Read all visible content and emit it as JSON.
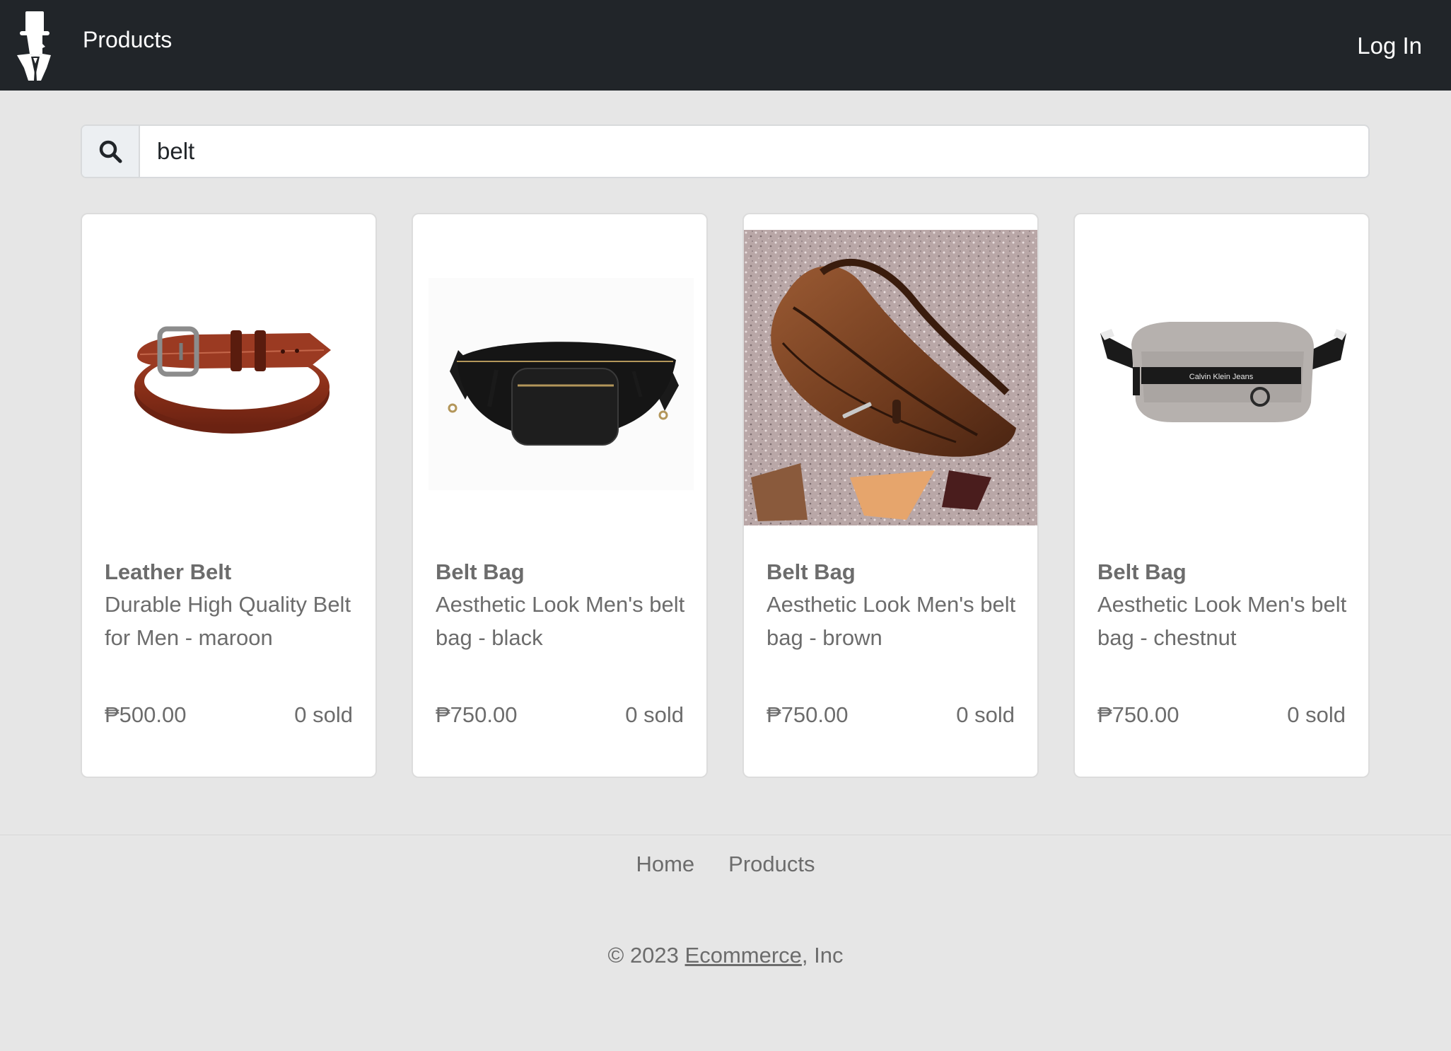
{
  "header": {
    "brand_icon": "top-hat-gentleman-logo",
    "products_link": "Products",
    "login_link": "Log In"
  },
  "search": {
    "icon": "search-icon",
    "value": "belt"
  },
  "products": [
    {
      "title": "Leather Belt",
      "description": "Durable High Quality Belt for Men - maroon",
      "price": "₱500.00",
      "sold": "0 sold",
      "image": "maroon-leather-belt"
    },
    {
      "title": "Belt Bag",
      "description": "Aesthetic Look Men's belt bag - black",
      "price": "₱750.00",
      "sold": "0 sold",
      "image": "black-belt-bag"
    },
    {
      "title": "Belt Bag",
      "description": "Aesthetic Look Men's belt bag - brown",
      "price": "₱750.00",
      "sold": "0 sold",
      "image": "brown-belt-bag"
    },
    {
      "title": "Belt Bag",
      "description": "Aesthetic Look Men's belt bag - chestnut",
      "price": "₱750.00",
      "sold": "0 sold",
      "image": "chestnut-belt-bag",
      "image_label": "Calvin Klein Jeans"
    }
  ],
  "footer": {
    "links": [
      "Home",
      "Products"
    ],
    "copyright_prefix": "© 2023",
    "copyright_link": "Ecommerce",
    "copyright_suffix": ", Inc"
  },
  "colors": {
    "navbar": "#212529",
    "page_background": "#e6e6e6",
    "text_muted": "#6c6c6c"
  }
}
